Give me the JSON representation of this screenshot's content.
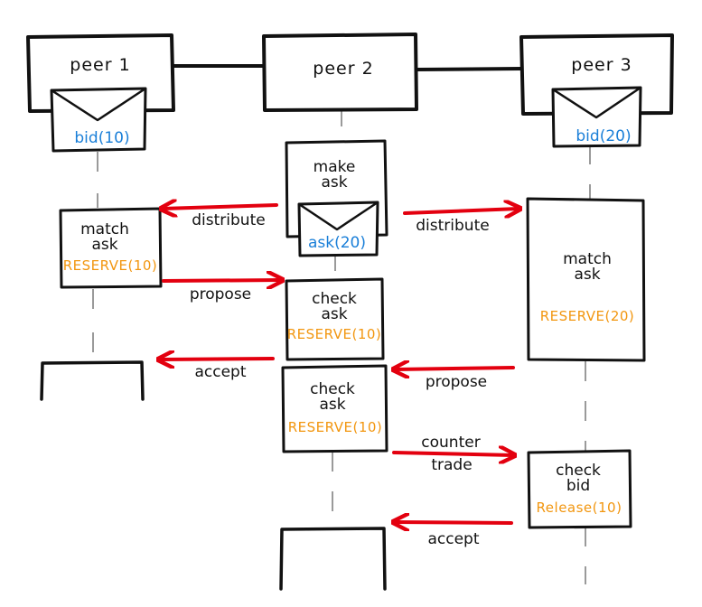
{
  "peers": [
    {
      "name": "peer 1",
      "order": "bid(10)"
    },
    {
      "name": "peer 2",
      "order": ""
    },
    {
      "name": "peer 3",
      "order": "bid(20)"
    }
  ],
  "steps": {
    "make_ask": {
      "line1": "make",
      "line2": "ask",
      "order": "ask(20)"
    },
    "match_ask_p1": {
      "line1": "match",
      "line2": "ask",
      "note": "RESERVE(10)"
    },
    "match_ask_p3": {
      "line1": "match",
      "line2": "ask",
      "note": "RESERVE(20)"
    },
    "check_ask_1": {
      "line1": "check",
      "line2": "ask",
      "note": "RESERVE(10)"
    },
    "check_ask_2": {
      "line1": "check",
      "line2": "ask",
      "note": "RESERVE(10)"
    },
    "check_bid": {
      "line1": "check",
      "line2": "bid",
      "note": "Release(10)"
    }
  },
  "messages": {
    "distribute_left": "distribute",
    "distribute_right": "distribute",
    "propose_p1": "propose",
    "accept_p1": "accept",
    "propose_p3": "propose",
    "counter_trade_1": "counter",
    "counter_trade_2": "trade",
    "accept_p3": "accept"
  },
  "colors": {
    "arrow": "#e3000f",
    "order": "#1a7fd8",
    "note": "#f2960f",
    "lifeline": "#9a9a9a"
  }
}
